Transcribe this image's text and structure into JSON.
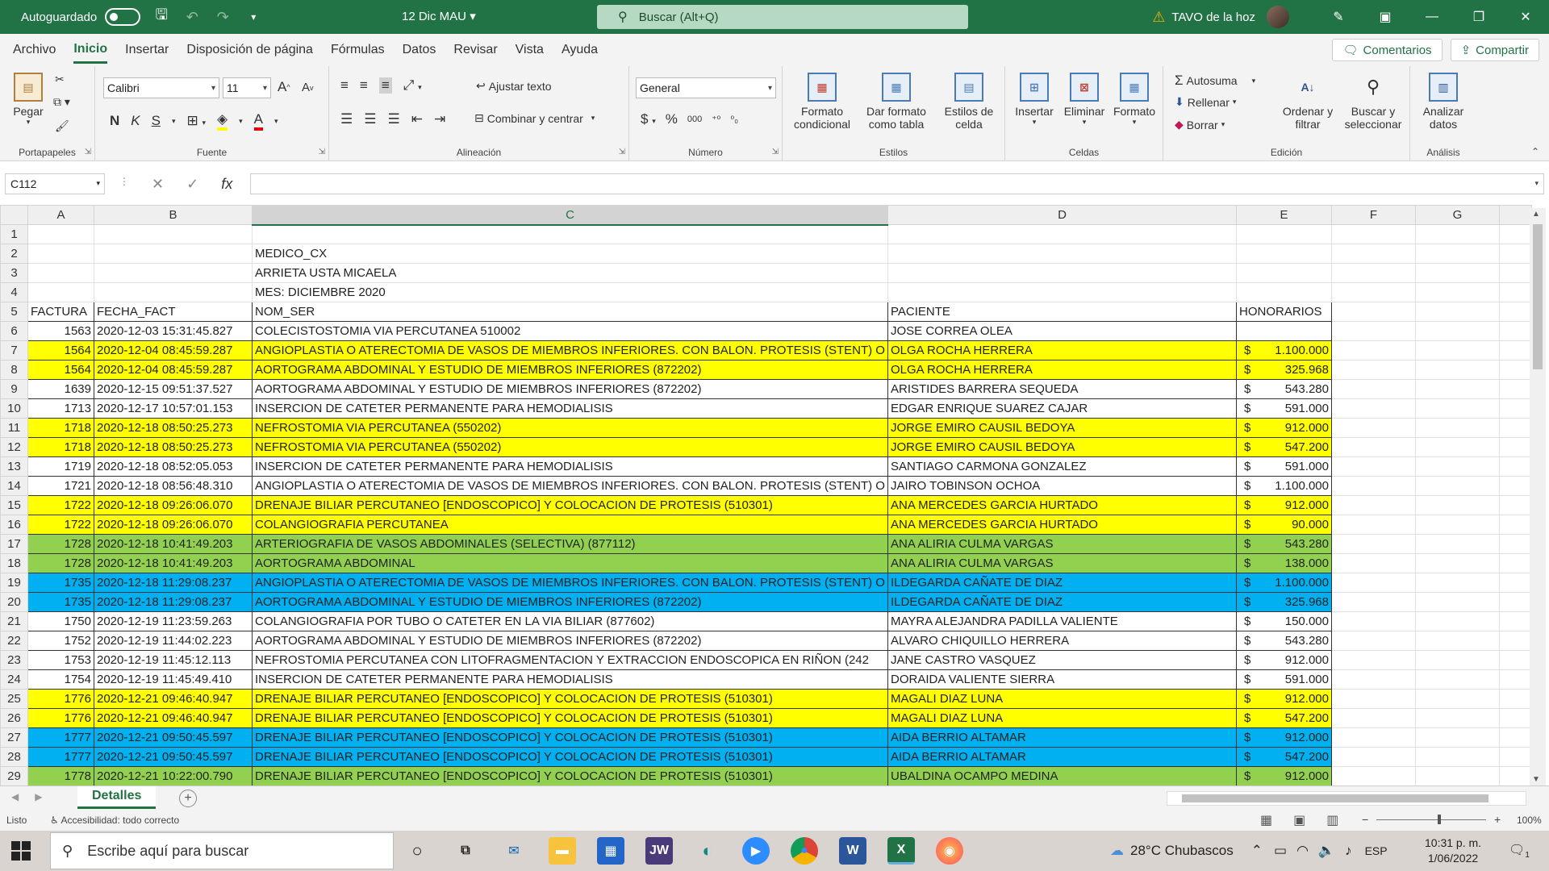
{
  "titlebar": {
    "autosave_label": "Autoguardado",
    "doc_title": "12 Dic MAU",
    "search_placeholder": "Buscar (Alt+Q)",
    "user_name": "TAVO de la hoz"
  },
  "ribbon_tabs": [
    "Archivo",
    "Inicio",
    "Insertar",
    "Disposición de página",
    "Fórmulas",
    "Datos",
    "Revisar",
    "Vista",
    "Ayuda"
  ],
  "active_tab": "Inicio",
  "ribbon_actions": {
    "comments": "Comentarios",
    "share": "Compartir"
  },
  "ribbon": {
    "portapapeles": {
      "label": "Portapapeles",
      "paste": "Pegar"
    },
    "fuente": {
      "label": "Fuente",
      "font": "Calibri",
      "size": "11",
      "bold": "N",
      "italic": "K",
      "underline": "S"
    },
    "alineacion": {
      "label": "Alineación",
      "wrap": "Ajustar texto",
      "merge": "Combinar y centrar"
    },
    "numero": {
      "label": "Número",
      "format": "General"
    },
    "estilos": {
      "label": "Estilos",
      "cond": "Formato condicional",
      "table": "Dar formato como tabla",
      "cell": "Estilos de celda"
    },
    "celdas": {
      "label": "Celdas",
      "insert": "Insertar",
      "delete": "Eliminar",
      "format": "Formato"
    },
    "edicion": {
      "label": "Edición",
      "autosum": "Autosuma",
      "fill": "Rellenar",
      "clear": "Borrar",
      "sort": "Ordenar y filtrar",
      "find": "Buscar y seleccionar"
    },
    "analisis": {
      "label": "Análisis",
      "analyze": "Analizar datos"
    }
  },
  "formula_bar": {
    "name_box": "C112",
    "formula": ""
  },
  "columns": [
    "A",
    "B",
    "C",
    "D",
    "E",
    "F",
    "G"
  ],
  "selected_column": "C",
  "rows": [
    {
      "n": "1",
      "a": "",
      "b": "",
      "c": "",
      "d": "",
      "e": "",
      "style": ""
    },
    {
      "n": "2",
      "a": "",
      "b": "",
      "c": "MEDICO_CX",
      "d": "",
      "e": "",
      "style": ""
    },
    {
      "n": "3",
      "a": "",
      "b": "",
      "c": "ARRIETA USTA MICAELA",
      "d": "",
      "e": "",
      "style": ""
    },
    {
      "n": "4",
      "a": "",
      "b": "",
      "c": "MES: DICIEMBRE 2020",
      "d": "",
      "e": "",
      "style": ""
    },
    {
      "n": "5",
      "a": "FACTURA",
      "b": "FECHA_FACT",
      "c": "NOM_SER",
      "d": "PACIENTE",
      "e": "HONORARIOS",
      "style": "hdr"
    },
    {
      "n": "6",
      "a": "1563",
      "b": "2020-12-03 15:31:45.827",
      "c": " COLECISTOSTOMIA VIA PERCUTANEA 510002",
      "d": "JOSE  CORREA OLEA",
      "e": "",
      "style": "w"
    },
    {
      "n": "7",
      "a": "1564",
      "b": "2020-12-04 08:45:59.287",
      "c": "ANGIOPLASTIA O ATERECTOMIA DE VASOS DE MIEMBROS INFERIORES. CON BALON.  PROTESIS (STENT) O",
      "d": "OLGA  ROCHA HERRERA",
      "e": "1.100.000",
      "style": "y"
    },
    {
      "n": "8",
      "a": "1564",
      "b": "2020-12-04 08:45:59.287",
      "c": " AORTOGRAMA ABDOMINAL Y ESTUDIO DE MIEMBROS INFERIORES (872202)",
      "d": "OLGA  ROCHA HERRERA",
      "e": "325.968",
      "style": "y"
    },
    {
      "n": "9",
      "a": "1639",
      "b": "2020-12-15 09:51:37.527",
      "c": " AORTOGRAMA ABDOMINAL Y ESTUDIO DE MIEMBROS INFERIORES (872202)",
      "d": "ARISTIDES  BARRERA SEQUEDA",
      "e": "543.280",
      "style": "w"
    },
    {
      "n": "10",
      "a": "1713",
      "b": "2020-12-17 10:57:01.153",
      "c": "INSERCION DE CATETER PERMANENTE PARA HEMODIALISIS",
      "d": "EDGAR ENRIQUE SUAREZ CAJAR",
      "e": "591.000",
      "style": "w"
    },
    {
      "n": "11",
      "a": "1718",
      "b": "2020-12-18 08:50:25.273",
      "c": " NEFROSTOMIA VIA PERCUTANEA (550202)",
      "d": "JORGE EMIRO CAUSIL BEDOYA",
      "e": "912.000",
      "style": "y"
    },
    {
      "n": "12",
      "a": "1718",
      "b": "2020-12-18 08:50:25.273",
      "c": " NEFROSTOMIA VIA PERCUTANEA (550202)",
      "d": "JORGE EMIRO CAUSIL BEDOYA",
      "e": "547.200",
      "style": "y"
    },
    {
      "n": "13",
      "a": "1719",
      "b": "2020-12-18 08:52:05.053",
      "c": "INSERCION DE CATETER PERMANENTE PARA HEMODIALISIS",
      "d": "SANTIAGO  CARMONA GONZALEZ",
      "e": "591.000",
      "style": "w"
    },
    {
      "n": "14",
      "a": "1721",
      "b": "2020-12-18 08:56:48.310",
      "c": "ANGIOPLASTIA O ATERECTOMIA DE VASOS DE MIEMBROS INFERIORES. CON BALON.  PROTESIS (STENT) O",
      "d": "JAIRO  TOBINSON OCHOA",
      "e": "1.100.000",
      "style": "w"
    },
    {
      "n": "15",
      "a": "1722",
      "b": "2020-12-18 09:26:06.070",
      "c": " DRENAJE BILIAR PERCUTANEO [ENDOSCOPICO] Y COLOCACION DE PROTESIS (510301)",
      "d": "ANA MERCEDES GARCIA HURTADO",
      "e": "912.000",
      "style": "y"
    },
    {
      "n": "16",
      "a": "1722",
      "b": "2020-12-18 09:26:06.070",
      "c": "COLANGIOGRAFIA PERCUTANEA",
      "d": "ANA MERCEDES GARCIA HURTADO",
      "e": "90.000",
      "style": "y"
    },
    {
      "n": "17",
      "a": "1728",
      "b": "2020-12-18 10:41:49.203",
      "c": " ARTERIOGRAFIA DE VASOS ABDOMINALES (SELECTIVA) (877112)",
      "d": "ANA ALIRIA CULMA VARGAS",
      "e": "543.280",
      "style": "g"
    },
    {
      "n": "18",
      "a": "1728",
      "b": "2020-12-18 10:41:49.203",
      "c": "AORTOGRAMA ABDOMINAL",
      "d": "ANA ALIRIA CULMA VARGAS",
      "e": "138.000",
      "style": "g"
    },
    {
      "n": "19",
      "a": "1735",
      "b": "2020-12-18 11:29:08.237",
      "c": "ANGIOPLASTIA O ATERECTOMIA DE VASOS DE MIEMBROS INFERIORES. CON BALON.  PROTESIS (STENT) O",
      "d": "ILDEGARDA  CAÑATE DE DIAZ",
      "e": "1.100.000",
      "style": "bl"
    },
    {
      "n": "20",
      "a": "1735",
      "b": "2020-12-18 11:29:08.237",
      "c": " AORTOGRAMA ABDOMINAL Y ESTUDIO DE MIEMBROS INFERIORES (872202)",
      "d": "ILDEGARDA  CAÑATE DE DIAZ",
      "e": "325.968",
      "style": "bl"
    },
    {
      "n": "21",
      "a": "1750",
      "b": "2020-12-19 11:23:59.263",
      "c": " COLANGIOGRAFIA POR TUBO O CATETER EN LA VIA BILIAR (877602)",
      "d": "MAYRA ALEJANDRA PADILLA VALIENTE",
      "e": "150.000",
      "style": "w"
    },
    {
      "n": "22",
      "a": "1752",
      "b": "2020-12-19 11:44:02.223",
      "c": " AORTOGRAMA ABDOMINAL Y ESTUDIO DE MIEMBROS INFERIORES (872202)",
      "d": "ALVARO  CHIQUILLO HERRERA",
      "e": "543.280",
      "style": "w"
    },
    {
      "n": "23",
      "a": "1753",
      "b": "2020-12-19 11:45:12.113",
      "c": "NEFROSTOMIA PERCUTANEA CON LITOFRAGMENTACION  Y EXTRACCION ENDOSCOPICA EN RIÑON    (242",
      "d": "JANE  CASTRO VASQUEZ",
      "e": "912.000",
      "style": "w"
    },
    {
      "n": "24",
      "a": "1754",
      "b": "2020-12-19 11:45:49.410",
      "c": "INSERCION DE CATETER PERMANENTE PARA HEMODIALISIS",
      "d": "DORAIDA  VALIENTE SIERRA",
      "e": "591.000",
      "style": "w"
    },
    {
      "n": "25",
      "a": "1776",
      "b": "2020-12-21 09:46:40.947",
      "c": " DRENAJE BILIAR PERCUTANEO [ENDOSCOPICO] Y COLOCACION DE PROTESIS (510301)",
      "d": "MAGALI  DIAZ LUNA",
      "e": "912.000",
      "style": "y"
    },
    {
      "n": "26",
      "a": "1776",
      "b": "2020-12-21 09:46:40.947",
      "c": " DRENAJE BILIAR PERCUTANEO [ENDOSCOPICO] Y COLOCACION DE PROTESIS (510301)",
      "d": "MAGALI  DIAZ LUNA",
      "e": "547.200",
      "style": "y"
    },
    {
      "n": "27",
      "a": "1777",
      "b": "2020-12-21 09:50:45.597",
      "c": " DRENAJE BILIAR PERCUTANEO [ENDOSCOPICO] Y COLOCACION DE PROTESIS (510301)",
      "d": "AIDA  BERRIO ALTAMAR",
      "e": "912.000",
      "style": "bl"
    },
    {
      "n": "28",
      "a": "1777",
      "b": "2020-12-21 09:50:45.597",
      "c": " DRENAJE BILIAR PERCUTANEO [ENDOSCOPICO] Y COLOCACION DE PROTESIS (510301)",
      "d": "AIDA  BERRIO ALTAMAR",
      "e": "547.200",
      "style": "bl"
    },
    {
      "n": "29",
      "a": "1778",
      "b": "2020-12-21 10:22:00.790",
      "c": " DRENAJE BILIAR PERCUTANEO [ENDOSCOPICO] Y COLOCACION DE PROTESIS (510301)",
      "d": "UBALDINA  OCAMPO MEDINA",
      "e": "912.000",
      "style": "g"
    }
  ],
  "currency_symbol": "$",
  "sheet_tab": "Detalles",
  "status": {
    "ready": "Listo",
    "accessibility": "Accesibilidad: todo correcto",
    "zoom": "100%"
  },
  "taskbar": {
    "search_placeholder": "Escribe aquí para buscar",
    "weather": "28°C  Chubascos",
    "lang": "ESP",
    "time": "10:31 p. m.",
    "date": "1/06/2022",
    "notifications": "1"
  },
  "colors": {
    "excel_green": "#217346",
    "yellow": "#ffff00",
    "green": "#92d050",
    "blue": "#00b0f0"
  }
}
